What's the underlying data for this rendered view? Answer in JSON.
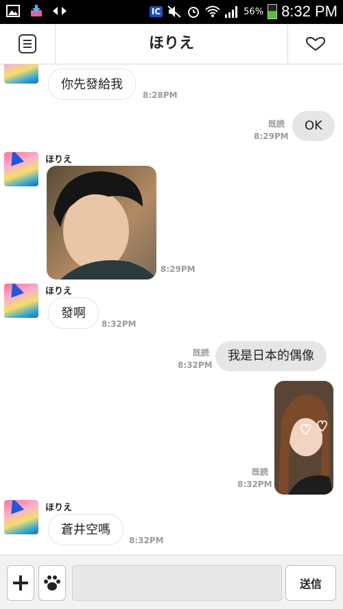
{
  "status_bar": {
    "battery_percent": "56%",
    "time": "8:32 PM",
    "ic_label": "IC"
  },
  "header": {
    "title": "ほりえ"
  },
  "messages": [
    {
      "side": "in",
      "sender": "ほりえ",
      "text": "你先發給我",
      "time": "8:28PM"
    },
    {
      "side": "out",
      "text": "OK",
      "read": "既読",
      "time": "8:29PM"
    },
    {
      "side": "in",
      "sender": "ほりえ",
      "type": "photo",
      "time": "8:29PM"
    },
    {
      "side": "in",
      "sender": "ほりえ",
      "text": "發啊",
      "time": "8:32PM"
    },
    {
      "side": "out",
      "text": "我是日本的偶像",
      "read": "既読",
      "time": "8:32PM"
    },
    {
      "side": "out",
      "type": "photo",
      "read": "既読",
      "time": "8:32PM"
    },
    {
      "side": "in",
      "sender": "ほりえ",
      "text": "蒼井空嗎",
      "time": "8:32PM"
    }
  ],
  "input_bar": {
    "plus_label": "+",
    "message_value": "",
    "send_label": "送信"
  },
  "icons": {
    "menu": "menu-icon",
    "like": "heart-chevron-icon",
    "plus": "plus-icon",
    "sticker": "paw-icon"
  }
}
